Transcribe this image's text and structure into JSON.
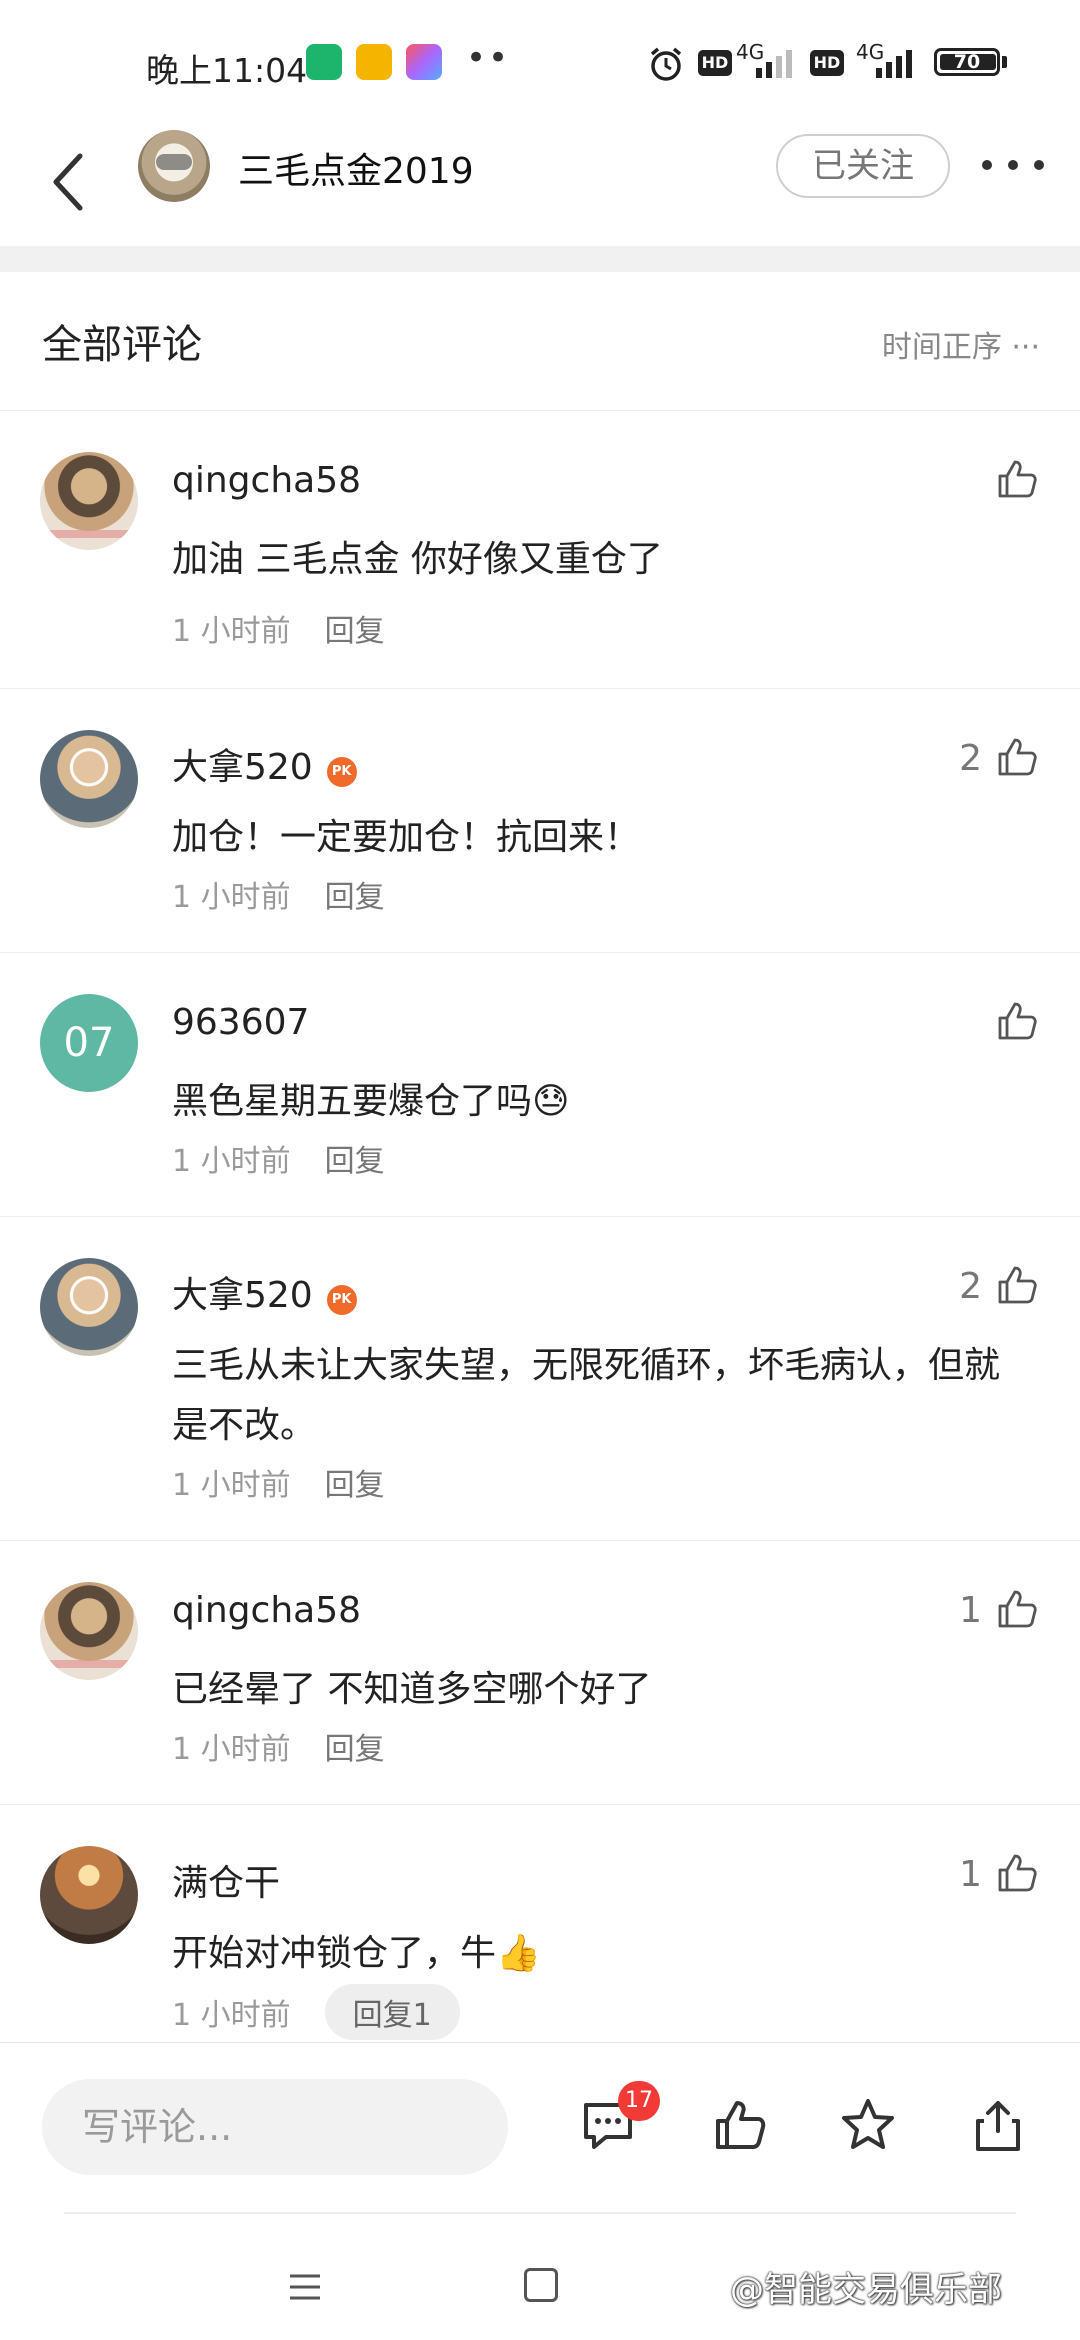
{
  "status_bar": {
    "time": "晚上11:04",
    "network_1": "4G",
    "network_2": "4G",
    "battery": "70",
    "battery_level": 0.7
  },
  "header": {
    "title": "三毛点金2019",
    "follow_label": "已关注"
  },
  "section": {
    "title": "全部评论",
    "sort_label": "时间正序 ···"
  },
  "comments": [
    {
      "user": "qingcha58",
      "text": "加油 三毛点金 你好像又重仓了",
      "time": "1 小时前",
      "reply": "回复",
      "likes": ""
    },
    {
      "user": "大拿520",
      "text": "加仓！一定要加仓！抗回来！",
      "time": "1 小时前",
      "reply": "回复",
      "likes": "2",
      "badge": "PK"
    },
    {
      "user": "963607",
      "avatar_text": "07",
      "text": "黑色星期五要爆仓了吗😓",
      "time": "1 小时前",
      "reply": "回复",
      "likes": ""
    },
    {
      "user": "大拿520",
      "text": "三毛从未让大家失望，无限死循环，坏毛病认，但就是不改。",
      "time": "1 小时前",
      "reply": "回复",
      "likes": "2",
      "badge": "PK"
    },
    {
      "user": "qingcha58",
      "text": "已经晕了 不知道多空哪个好了",
      "time": "1 小时前",
      "reply": "回复",
      "likes": "1"
    },
    {
      "user": "满仓干",
      "text": "开始对冲锁仓了，牛👍",
      "time": "1 小时前",
      "reply": "回复1",
      "likes": "1"
    }
  ],
  "bottom_bar": {
    "input_placeholder": "写评论...",
    "comment_count": "17"
  },
  "watermark": "@智能交易俱乐部",
  "colors": {
    "accent_badge": "#f23b36",
    "avatar_teal": "#5fb8a4",
    "pk_badge": "#f06a2b"
  }
}
